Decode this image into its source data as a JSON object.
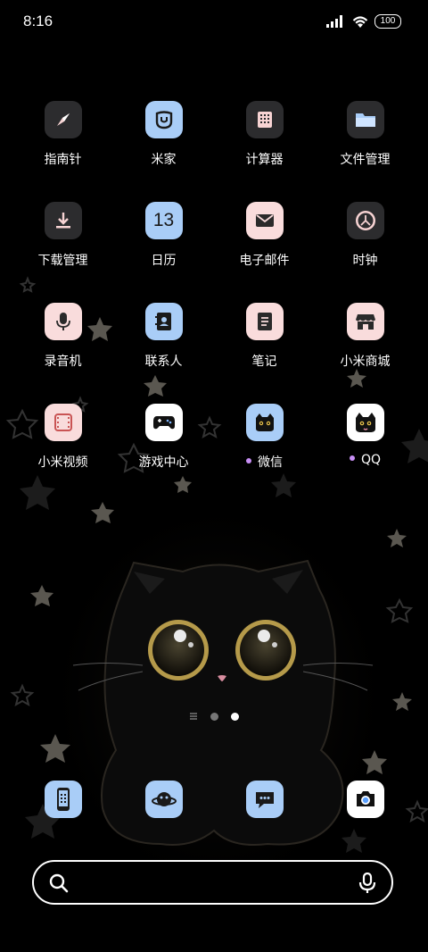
{
  "status_bar": {
    "time": "8:16",
    "battery": "100"
  },
  "apps": [
    {
      "label": "指南针",
      "icon": "compass-icon",
      "badge": false
    },
    {
      "label": "米家",
      "icon": "mijia-icon",
      "badge": false
    },
    {
      "label": "计算器",
      "icon": "calculator-icon",
      "badge": false
    },
    {
      "label": "文件管理",
      "icon": "folder-icon",
      "badge": false
    },
    {
      "label": "下载管理",
      "icon": "download-icon",
      "badge": false
    },
    {
      "label": "日历",
      "icon": "calendar-icon",
      "badge": false,
      "icon_text": "13"
    },
    {
      "label": "电子邮件",
      "icon": "mail-icon",
      "badge": false
    },
    {
      "label": "时钟",
      "icon": "clock-icon",
      "badge": false
    },
    {
      "label": "录音机",
      "icon": "microphone-icon",
      "badge": false
    },
    {
      "label": "联系人",
      "icon": "contacts-icon",
      "badge": false
    },
    {
      "label": "笔记",
      "icon": "notes-icon",
      "badge": false
    },
    {
      "label": "小米商城",
      "icon": "store-icon",
      "badge": false
    },
    {
      "label": "小米视频",
      "icon": "video-icon",
      "badge": false
    },
    {
      "label": "游戏中心",
      "icon": "gamepad-icon",
      "badge": false
    },
    {
      "label": "微信",
      "icon": "wechat-cat-icon",
      "badge": true
    },
    {
      "label": "QQ",
      "icon": "qq-cat-icon",
      "badge": true
    }
  ],
  "dock": [
    {
      "icon": "phone-icon"
    },
    {
      "icon": "browser-icon"
    },
    {
      "icon": "messages-icon"
    },
    {
      "icon": "camera-icon"
    }
  ],
  "page_indicator": {
    "pages": 2,
    "active": 2
  },
  "colors": {
    "icon_dark": "#2c2c2e",
    "icon_blue": "#a9cdf7",
    "icon_pink": "#f9dcdc",
    "badge": "#c88ff5"
  }
}
